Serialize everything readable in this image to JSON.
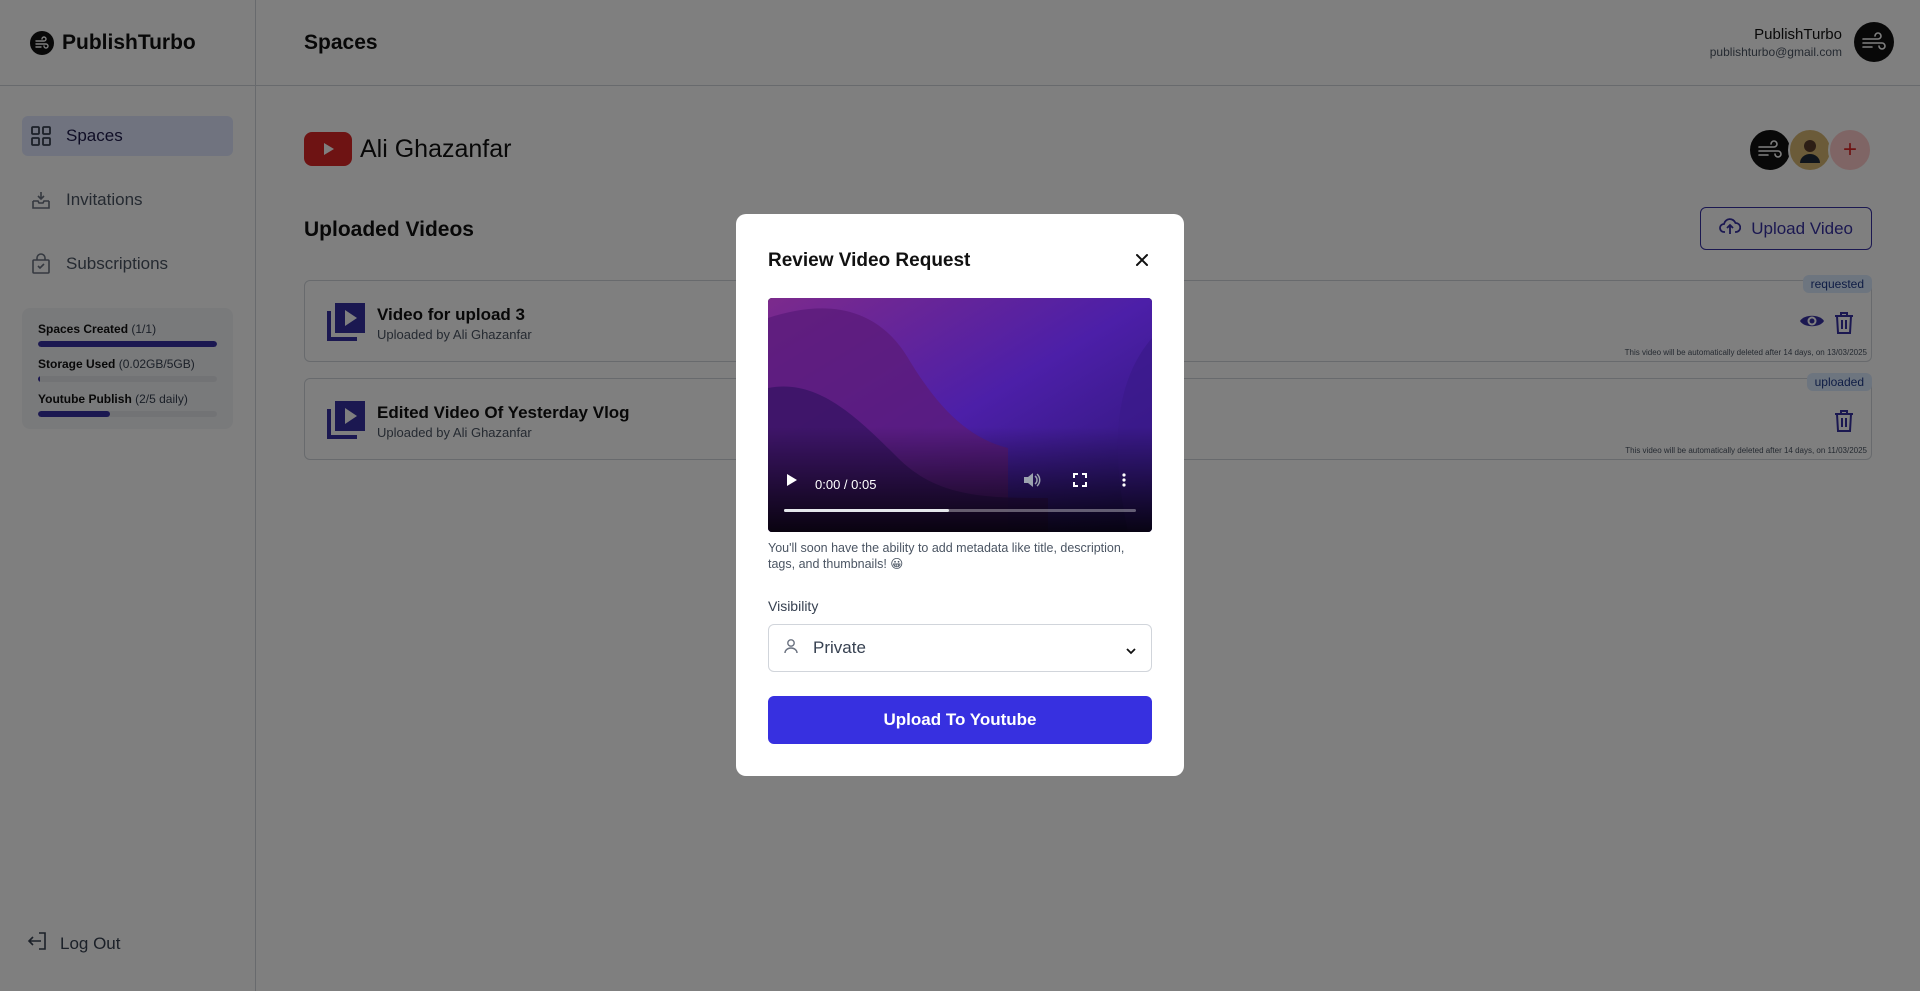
{
  "app": {
    "name": "PublishTurbo"
  },
  "sidebar": {
    "items": [
      {
        "label": "Spaces",
        "icon": "grid-icon",
        "active": true
      },
      {
        "label": "Invitations",
        "icon": "inbox-icon",
        "active": false
      },
      {
        "label": "Subscriptions",
        "icon": "shopping-bag-icon",
        "active": false
      }
    ],
    "usage": [
      {
        "label": "Spaces Created",
        "detail": "(1/1)",
        "fraction": 1.0
      },
      {
        "label": "Storage Used",
        "detail": "(0.02GB/5GB)",
        "fraction": 0.004
      },
      {
        "label": "Youtube Publish",
        "detail": "(2/5 daily)",
        "fraction": 0.4
      }
    ],
    "logout_label": "Log Out"
  },
  "header": {
    "title": "Spaces",
    "user_name": "PublishTurbo",
    "user_email": "publishturbo@gmail.com"
  },
  "space": {
    "name": "Ali Ghazanfar",
    "section_title": "Uploaded Videos",
    "upload_button": "Upload Video",
    "add_member": "+",
    "videos": [
      {
        "title": "Video for upload 3",
        "uploader": "Uploaded by Ali Ghazanfar",
        "status": "requested",
        "note": "This video will be automatically deleted after 14 days, on 13/03/2025"
      },
      {
        "title": "Edited Video Of Yesterday Vlog",
        "uploader": "Uploaded by Ali Ghazanfar",
        "status": "uploaded",
        "note": "This video will be automatically deleted after 14 days, on 11/03/2025"
      }
    ]
  },
  "modal": {
    "title": "Review Video Request",
    "video_time": "0:00 / 0:05",
    "video_progress": 0.47,
    "note": "You'll soon have the ability to add metadata like title, description, tags, and thumbnails! 😀",
    "visibility_label": "Visibility",
    "visibility_value": "Private",
    "submit_label": "Upload To Youtube"
  },
  "colors": {
    "accent": "#3730a3",
    "primary_button": "#3730e0",
    "youtube_red": "#dc2626",
    "badge_bg": "#dbeafe"
  }
}
